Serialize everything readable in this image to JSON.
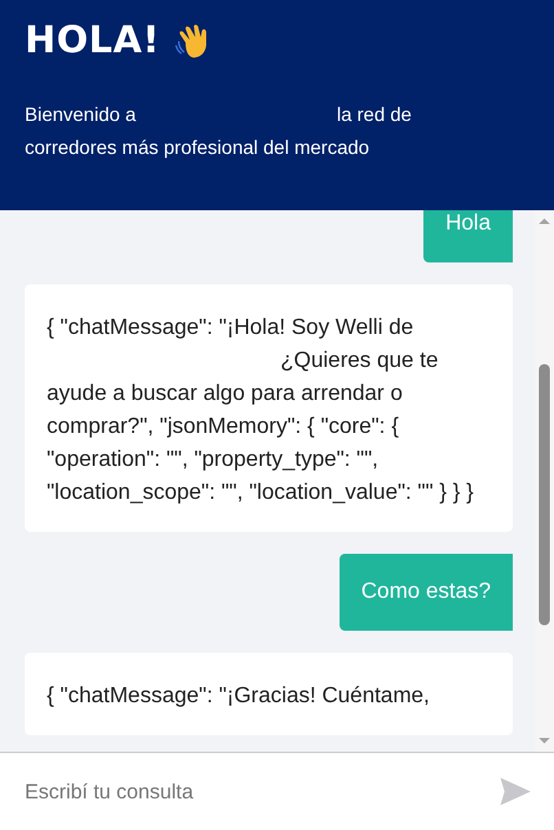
{
  "header": {
    "title": "HOLA!",
    "intro_before": "Bienvenido a",
    "intro_after": "la red de corredores más profesional del mercado"
  },
  "messages": [
    {
      "kind": "user",
      "text": "Hola"
    },
    {
      "kind": "bot",
      "before": "{ \"chatMessage\": \"¡Hola! Soy Welli de",
      "after": "¿Quieres que te ayude a buscar algo para arrendar o comprar?\", \"jsonMemory\": { \"core\": { \"operation\": \"\", \"property_type\": \"\", \"location_scope\": \"\", \"location_value\": \"\" } } }"
    },
    {
      "kind": "user",
      "text": "Como estas?"
    },
    {
      "kind": "bot",
      "before": "{ \"chatMessage\": \"¡Gracias! Cuéntame,"
    }
  ],
  "composer": {
    "placeholder": "Escribí tu consulta"
  }
}
